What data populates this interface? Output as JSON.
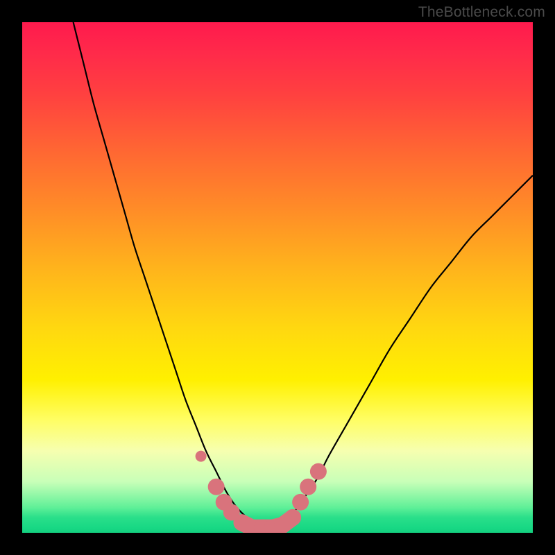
{
  "watermark": "TheBottleneck.com",
  "colors": {
    "background": "#000000",
    "watermark": "#4a4a4a",
    "curve": "#000000",
    "markers": "#d9737c"
  },
  "chart_data": {
    "type": "line",
    "title": "",
    "xlabel": "",
    "ylabel": "",
    "xlim": [
      0,
      100
    ],
    "ylim": [
      0,
      100
    ],
    "grid": false,
    "legend": false,
    "series": [
      {
        "name": "bottleneck-curve",
        "x": [
          10,
          12,
          14,
          16,
          18,
          20,
          22,
          24,
          26,
          28,
          30,
          32,
          34,
          36,
          38,
          40,
          42,
          44,
          46,
          48,
          50,
          52,
          54,
          56,
          58,
          60,
          64,
          68,
          72,
          76,
          80,
          84,
          88,
          92,
          96,
          100
        ],
        "y": [
          100,
          92,
          84,
          77,
          70,
          63,
          56,
          50,
          44,
          38,
          32,
          26,
          21,
          16,
          12,
          8,
          5,
          3,
          1.5,
          1,
          1.5,
          3,
          5,
          8,
          11,
          15,
          22,
          29,
          36,
          42,
          48,
          53,
          58,
          62,
          66,
          70
        ]
      }
    ],
    "markers": [
      {
        "x": 35,
        "y": 15
      },
      {
        "x": 38,
        "y": 9
      },
      {
        "x": 39.5,
        "y": 6
      },
      {
        "x": 41,
        "y": 4
      },
      {
        "x": 43,
        "y": 2
      },
      {
        "x": 45,
        "y": 1
      },
      {
        "x": 47,
        "y": 1
      },
      {
        "x": 49,
        "y": 1
      },
      {
        "x": 51,
        "y": 1.5
      },
      {
        "x": 53,
        "y": 3
      },
      {
        "x": 54.5,
        "y": 6
      },
      {
        "x": 56,
        "y": 9
      },
      {
        "x": 58,
        "y": 12
      }
    ],
    "gradient_stops": [
      {
        "pos": 0,
        "color": "#ff1a4d"
      },
      {
        "pos": 50,
        "color": "#ffb31c"
      },
      {
        "pos": 75,
        "color": "#fff000"
      },
      {
        "pos": 100,
        "color": "#14d080"
      }
    ]
  }
}
